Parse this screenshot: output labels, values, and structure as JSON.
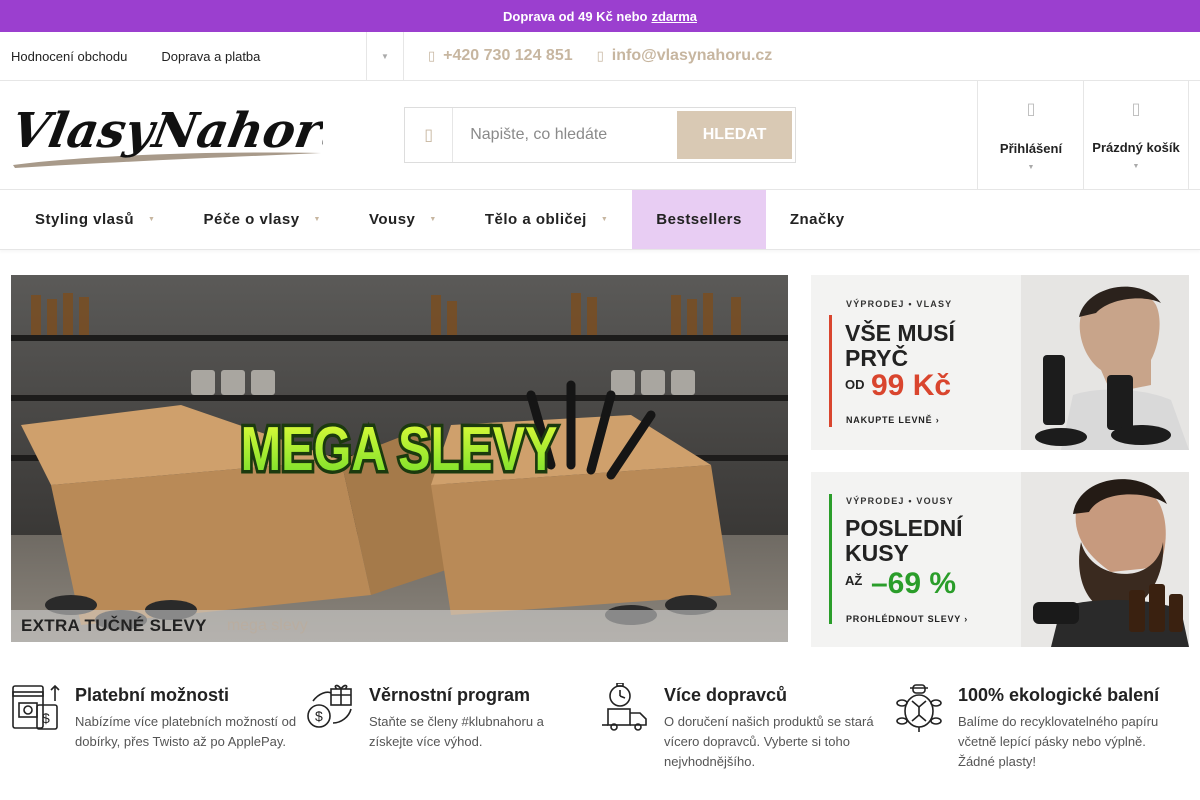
{
  "announcement": {
    "text": "Doprava od 49 Kč nebo",
    "link": "zdarma"
  },
  "utility": {
    "links": [
      "Hodnocení obchodu",
      "Doprava a platba"
    ],
    "phone": "+420 730 124 851",
    "email": "info@vlasynahoru.cz"
  },
  "header": {
    "logo_text": "VlasyNahoru",
    "search_placeholder": "Napište, co hledáte",
    "search_button": "HLEDAT",
    "login_label": "Přihlášení",
    "cart_label": "Prázdný košík"
  },
  "nav": [
    {
      "label": "Styling vlasů",
      "dropdown": true
    },
    {
      "label": "Péče o vlasy",
      "dropdown": true
    },
    {
      "label": "Vousy",
      "dropdown": true
    },
    {
      "label": "Tělo a obličej",
      "dropdown": true
    },
    {
      "label": "Bestsellers",
      "dropdown": false,
      "highlight": true
    },
    {
      "label": "Značky",
      "dropdown": false
    }
  ],
  "hero": {
    "headline": "MEGA SLEVY",
    "caption_title": "EXTRA TUČNÉ SLEVY",
    "caption_sub": "mega slevy"
  },
  "banners": [
    {
      "tag": "VÝPRODEJ • VLASY",
      "line1": "VŠE MUSÍ",
      "line2": "PRYČ",
      "prefix": "OD",
      "price": "99 Kč",
      "cta": "NAKUPTE LEVNĚ ›",
      "accent": "#d9452e"
    },
    {
      "tag": "VÝPRODEJ • VOUSY",
      "line1": "POSLEDNÍ",
      "line2": "KUSY",
      "prefix": "AŽ",
      "price": "–69 %",
      "cta": "PROHLÉDNOUT SLEVY ›",
      "accent": "#2a9d2a"
    }
  ],
  "features": [
    {
      "title": "Platební možnosti",
      "text": "Nabízíme více platebních možností od dobírky, přes Twisto až po ApplePay.",
      "icon": "payment-icon"
    },
    {
      "title": "Věrnostní program",
      "text": "Staňte se členy #klubnahoru a získejte více výhod.",
      "icon": "loyalty-icon"
    },
    {
      "title": "Více dopravců",
      "text": "O doručení našich produktů se stará vícero dopravců. Vyberte si toho nejvhodnějšího.",
      "icon": "delivery-icon"
    },
    {
      "title": "100% ekologické balení",
      "text": "Balíme do recyklovatelného papíru včetně lepící pásky nebo výplně. Žádné plasty!",
      "icon": "turtle-icon"
    }
  ],
  "colors": {
    "purple": "#9b3fcf",
    "beige": "#d9c9b4",
    "nav_highlight": "#e8cdf3"
  }
}
